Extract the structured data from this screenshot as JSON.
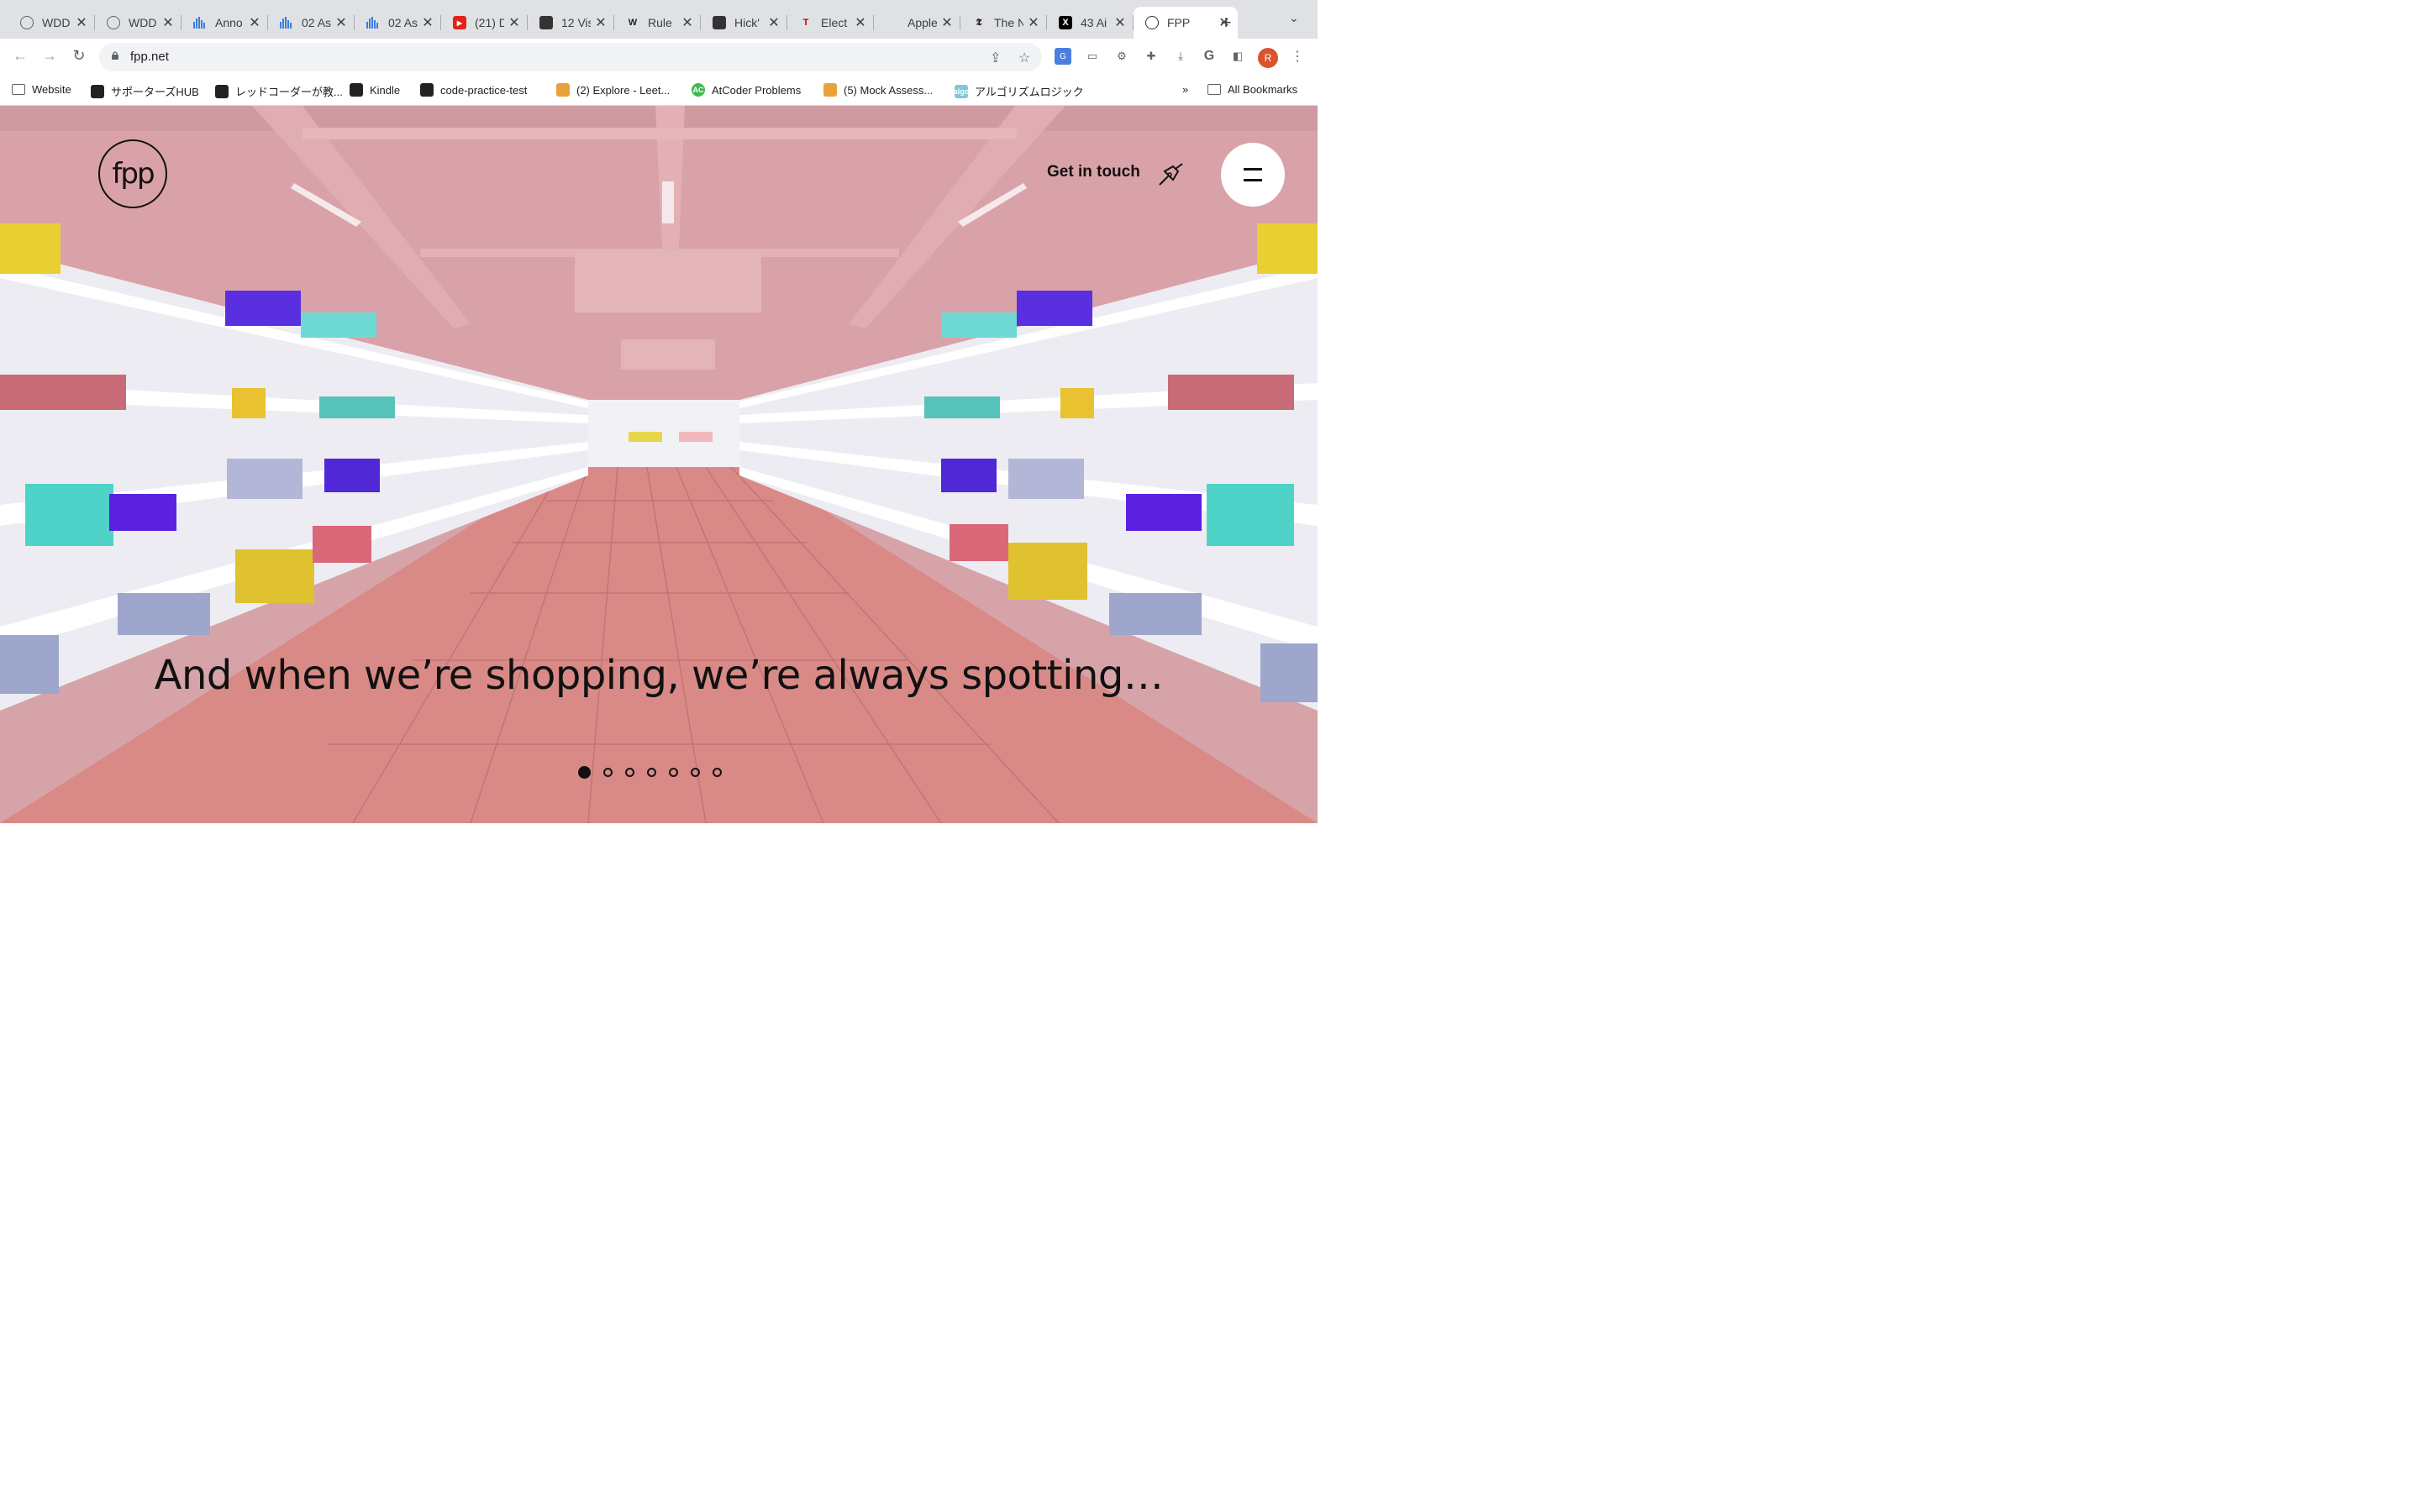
{
  "browser": {
    "tabs": [
      {
        "title": "WDD",
        "icon": "globe-icon"
      },
      {
        "title": "WDD",
        "icon": "globe-icon"
      },
      {
        "title": "Anno",
        "icon": "bar-chart-icon"
      },
      {
        "title": "02 As",
        "icon": "bar-chart-icon"
      },
      {
        "title": "02 As",
        "icon": "bar-chart-icon"
      },
      {
        "title": "(21) D",
        "icon": "youtube-icon"
      },
      {
        "title": "12 Vis",
        "icon": "app-icon"
      },
      {
        "title": "Rule",
        "icon": "wikipedia-icon",
        "glyph": "W"
      },
      {
        "title": "Hick'",
        "icon": "app-icon"
      },
      {
        "title": "Elect",
        "icon": "tesla-icon",
        "glyph": "T"
      },
      {
        "title": "Apple",
        "icon": "apple-icon",
        "glyph": ""
      },
      {
        "title": "The N",
        "icon": "nyt-icon",
        "glyph": "𝕿"
      },
      {
        "title": "43 Ai",
        "icon": "x-icon",
        "glyph": "X"
      },
      {
        "title": "FPP",
        "icon": "fpp-icon",
        "active": true
      }
    ],
    "url": "fpp.net",
    "profile_initial": "R",
    "bookmarks": [
      {
        "label": "Website",
        "icon": "folder-icon"
      },
      {
        "label": "サポーターズHUB",
        "icon": "app-icon"
      },
      {
        "label": "レッドコーダーが教...",
        "icon": "app-icon"
      },
      {
        "label": "Kindle",
        "icon": "kindle-icon"
      },
      {
        "label": "code-practice-test",
        "icon": "app-icon"
      },
      {
        "label": "(2) Explore - Leet...",
        "icon": "leetcode-icon"
      },
      {
        "label": "AtCoder Problems",
        "icon": "atcoder-icon",
        "glyph": "AC"
      },
      {
        "label": "(5) Mock Assess...",
        "icon": "leetcode-icon"
      },
      {
        "label": "アルゴリズムロジック",
        "icon": "algo-icon",
        "glyph": "algo"
      }
    ],
    "bookmarks_overflow": "»",
    "all_bookmarks": "All Bookmarks"
  },
  "site": {
    "logo_text": "fpp",
    "cta_label": "Get in touch",
    "headline": "And when we’re shopping, we’re always spotting…",
    "slides": {
      "count": 7,
      "active_index": 0
    }
  },
  "colors": {
    "ceiling": "#d9a2a8",
    "floor": "#d98a86",
    "shelf": "#f4f4f8",
    "text": "#111111"
  }
}
